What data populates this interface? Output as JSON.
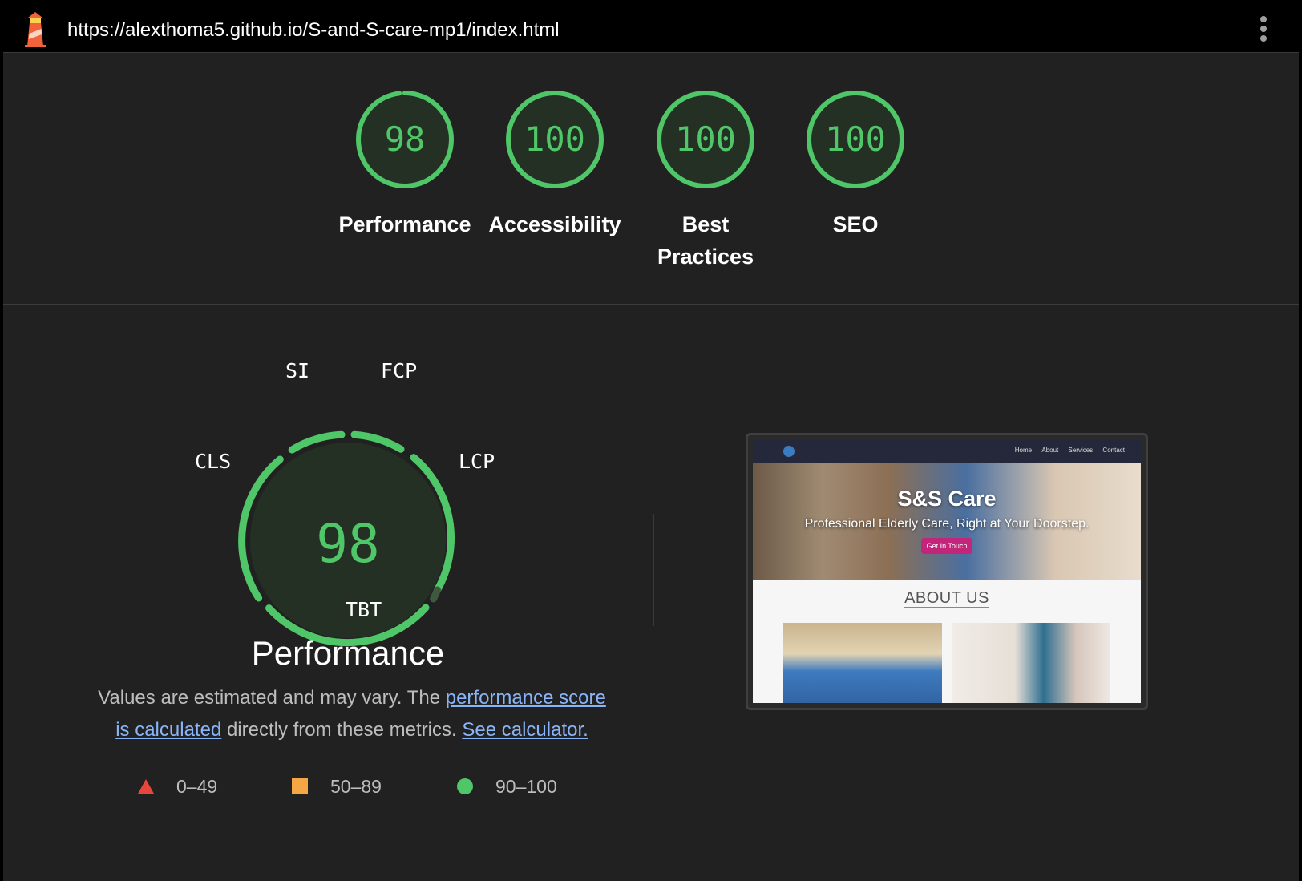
{
  "header": {
    "url": "https://alexthoma5.github.io/S-and-S-care-mp1/index.html"
  },
  "gauges": [
    {
      "score": "98",
      "label": "Performance"
    },
    {
      "score": "100",
      "label": "Accessibility"
    },
    {
      "score": "100",
      "label": "Best Practices"
    },
    {
      "score": "100",
      "label": "SEO"
    }
  ],
  "performance": {
    "score": "98",
    "title": "Performance",
    "metrics": {
      "si": "SI",
      "fcp": "FCP",
      "lcp": "LCP",
      "tbt": "TBT",
      "cls": "CLS"
    },
    "description_pre": "Values are estimated and may vary. The ",
    "description_link1": "performance score is calculated",
    "description_mid": " directly from these metrics. ",
    "description_link2": "See calculator.",
    "legend": [
      {
        "shape": "triangle",
        "range": "0–49",
        "color": "#e8453c"
      },
      {
        "shape": "square",
        "range": "50–89",
        "color": "#f4a742"
      },
      {
        "shape": "circle",
        "range": "90–100",
        "color": "#4fc768"
      }
    ]
  },
  "thumbnail": {
    "nav_links": [
      "Home",
      "About",
      "Services",
      "Contact"
    ],
    "hero_title": "S&S Care",
    "hero_subtitle": "Professional Elderly Care, Right at Your Doorstep.",
    "hero_button": "Get In Touch",
    "about_heading": "ABOUT US"
  },
  "colors": {
    "pass": "#4fc768",
    "gauge_bg": "#253025",
    "page_bg": "#212121",
    "link": "#8ab4f8"
  }
}
